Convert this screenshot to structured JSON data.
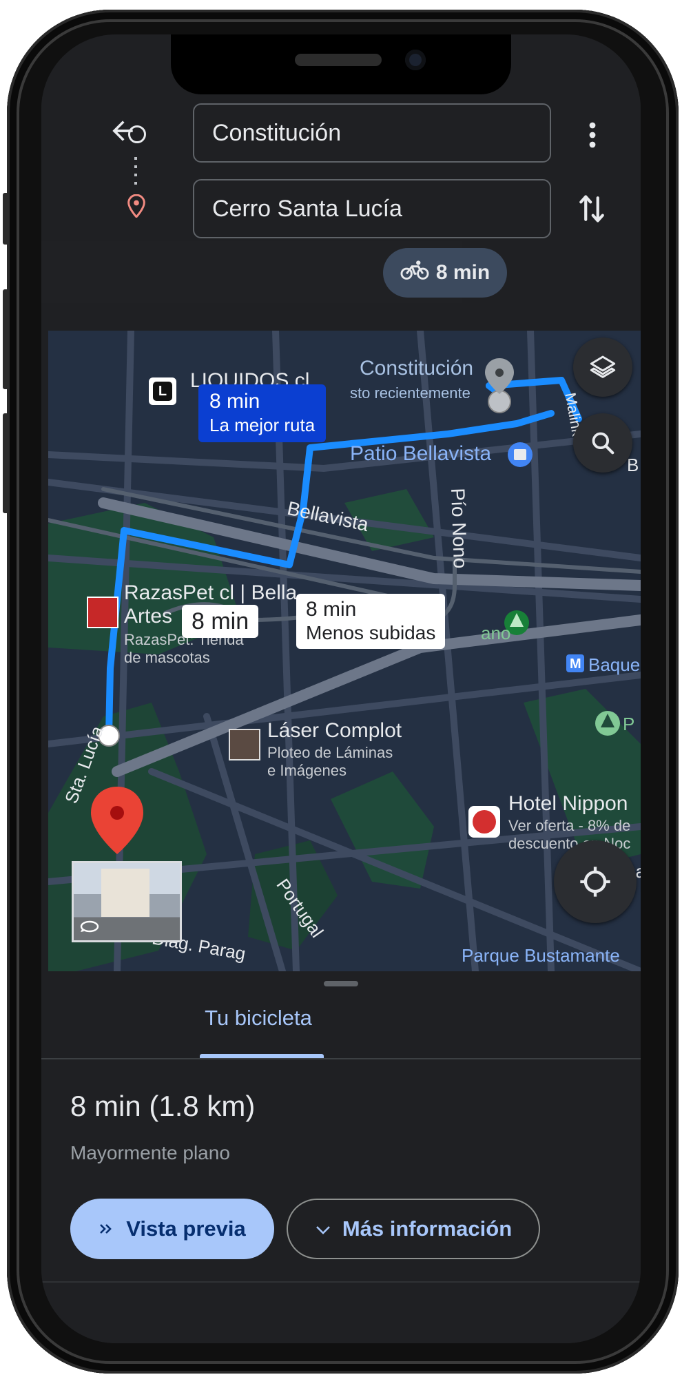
{
  "search": {
    "origin": "Constitución",
    "destination": "Cerro Santa Lucía"
  },
  "mode_chip": {
    "label": "8 min",
    "icon": "bike-icon"
  },
  "map": {
    "best_route": {
      "time": "8 min",
      "label": "La mejor ruta"
    },
    "alt_route_1": {
      "time": "8 min"
    },
    "alt_route_2": {
      "time": "8 min",
      "label": "Menos subidas"
    },
    "places": {
      "liquidos": "LIQUIDOS cl",
      "constitucion": "Constitución",
      "constitucion_sub": "sto recientemente",
      "patio_bellavista": "Patio Bellavista",
      "malinkrodt": "Malink",
      "bellavista": "Bellavista",
      "pio_nono": "Pío Nono",
      "razaspet": "RazasPet cl | Bella",
      "razaspet2": "Artes",
      "razaspet_sub1": "RazasPet: Tienda",
      "razaspet_sub2": "de mascotas",
      "laser": "Láser Complot",
      "laser_sub1": "Ploteo de Láminas",
      "laser_sub2": "e Imágenes",
      "hotel": "Hotel Nippon",
      "hotel_sub1": "Ver oferta - 8% de",
      "hotel_sub2": "descuento en Noc",
      "baque": "Baque",
      "parque": "Parque Bustamante",
      "sta_lucia": "Sta. Lucía",
      "portugal": "Portugal",
      "diag": "Diag. Parag",
      "p": "P",
      "b": "B",
      "ua": "ua",
      "ano": "ano"
    }
  },
  "tabs": [
    {
      "label": "Tu bicicleta",
      "active": true
    }
  ],
  "summary": {
    "time_distance": "8 min (1.8 km)",
    "terrain": "Mayormente plano"
  },
  "buttons": {
    "preview": "Vista previa",
    "more_info": "Más información"
  },
  "colors": {
    "route": "#1a8cff",
    "best_route_bubble": "#0b3fd1",
    "accent": "#a8c7fa",
    "pin": "#ea4335"
  }
}
